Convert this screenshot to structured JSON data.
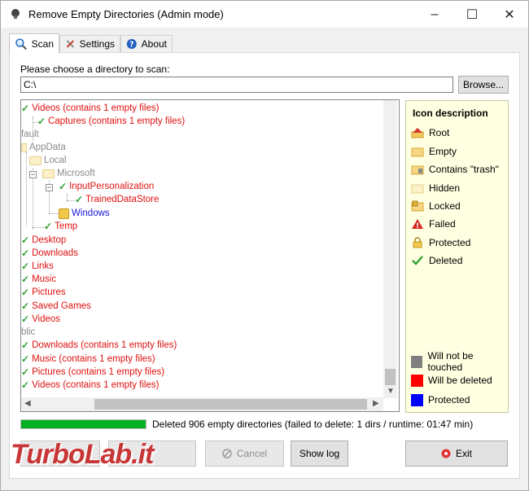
{
  "window": {
    "title": "Remove Empty Directories (Admin mode)",
    "controls": {
      "minimize": "–",
      "maximize": "☐",
      "close": "✕"
    }
  },
  "tabs": [
    {
      "label": "Scan",
      "icon": "magnifier-icon",
      "active": true
    },
    {
      "label": "Settings",
      "icon": "tools-icon",
      "active": false
    },
    {
      "label": "About",
      "icon": "help-icon",
      "active": false
    }
  ],
  "scan": {
    "dir_label": "Please choose a directory to scan:",
    "path_value": "C:\\",
    "browse_label": "Browse..."
  },
  "tree": {
    "rows": [
      {
        "text": "Videos (contains 1 empty files)",
        "color": "red",
        "icon": "check"
      },
      {
        "text": "Captures (contains 1 empty files)",
        "color": "red",
        "icon": "check"
      },
      {
        "text": "fault",
        "color": "gray",
        "icon": "none"
      },
      {
        "text": "AppData",
        "color": "gray",
        "icon": "folder"
      },
      {
        "text": "Local",
        "color": "gray",
        "icon": "folder"
      },
      {
        "text": "Microsoft",
        "color": "gray",
        "icon": "folder"
      },
      {
        "text": "InputPersonalization",
        "color": "red",
        "icon": "check"
      },
      {
        "text": "TrainedDataStore",
        "color": "red",
        "icon": "check"
      },
      {
        "text": "Windows",
        "color": "blue",
        "icon": "lock"
      },
      {
        "text": "Temp",
        "color": "red",
        "icon": "check"
      },
      {
        "text": "Desktop",
        "color": "red",
        "icon": "check"
      },
      {
        "text": "Downloads",
        "color": "red",
        "icon": "check"
      },
      {
        "text": "Links",
        "color": "red",
        "icon": "check"
      },
      {
        "text": "Music",
        "color": "red",
        "icon": "check"
      },
      {
        "text": "Pictures",
        "color": "red",
        "icon": "check"
      },
      {
        "text": "Saved Games",
        "color": "red",
        "icon": "check"
      },
      {
        "text": "Videos",
        "color": "red",
        "icon": "check"
      },
      {
        "text": "blic",
        "color": "gray",
        "icon": "none"
      },
      {
        "text": "Downloads (contains 1 empty files)",
        "color": "red",
        "icon": "check"
      },
      {
        "text": "Music (contains 1 empty files)",
        "color": "red",
        "icon": "check"
      },
      {
        "text": "Pictures (contains 1 empty files)",
        "color": "red",
        "icon": "check"
      },
      {
        "text": "Videos (contains 1 empty files)",
        "color": "red",
        "icon": "check"
      }
    ]
  },
  "legend": {
    "title": "Icon description",
    "items": [
      {
        "label": "Root",
        "icon": "root-folder-icon"
      },
      {
        "label": "Empty",
        "icon": "empty-folder-icon"
      },
      {
        "label": "Contains \"trash\"",
        "icon": "trash-folder-icon"
      },
      {
        "label": "Hidden",
        "icon": "hidden-folder-icon"
      },
      {
        "label": "Locked",
        "icon": "locked-folder-icon"
      },
      {
        "label": "Failed",
        "icon": "warning-icon"
      },
      {
        "label": "Protected",
        "icon": "lock-icon"
      },
      {
        "label": "Deleted",
        "icon": "checkmark-icon"
      }
    ],
    "colors": [
      {
        "label": "Will not be touched",
        "color": "#808080"
      },
      {
        "label": "Will be deleted",
        "color": "#ff0000"
      },
      {
        "label": "Protected",
        "color": "#0000ff"
      }
    ]
  },
  "status": {
    "progress_fraction": 1.0,
    "text": "Deleted 906 empty directories (failed to delete: 1 dirs / runtime: 01:47 min)"
  },
  "buttons": {
    "cancel": "Cancel",
    "show_log": "Show log",
    "exit": "Exit"
  },
  "watermark": "TurboLab.it",
  "colors": {
    "deleted_text": "#e01010",
    "untouched_text": "#8a8a8a",
    "protected_text": "#1515d6",
    "legend_bg": "#ffffe1",
    "progress": "#06b025"
  }
}
